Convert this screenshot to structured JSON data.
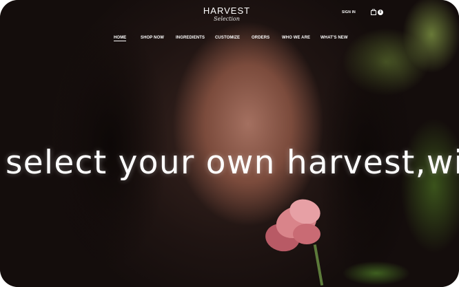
{
  "brand": {
    "name": "HARVEST",
    "tagline": "Selection"
  },
  "top_actions": {
    "sign_in": "SIGN IN",
    "cart_count": "0"
  },
  "nav": {
    "items": [
      {
        "label": "HOME",
        "active": true
      },
      {
        "label": "SHOP NOW",
        "active": false
      },
      {
        "label": "INGREDIENTS",
        "active": false
      },
      {
        "label": "CUSTOMIZE",
        "active": false
      },
      {
        "label": "ORDERS",
        "active": false
      },
      {
        "label": "WHO WE ARE",
        "active": false
      },
      {
        "label": "WHAT'S NEW",
        "active": false
      }
    ]
  },
  "hero": {
    "headline": "select your own harvest,with"
  },
  "icons": {
    "cart": "shopping-bag-icon"
  },
  "colors": {
    "text": "#ffffff",
    "background": "#1f1412"
  }
}
